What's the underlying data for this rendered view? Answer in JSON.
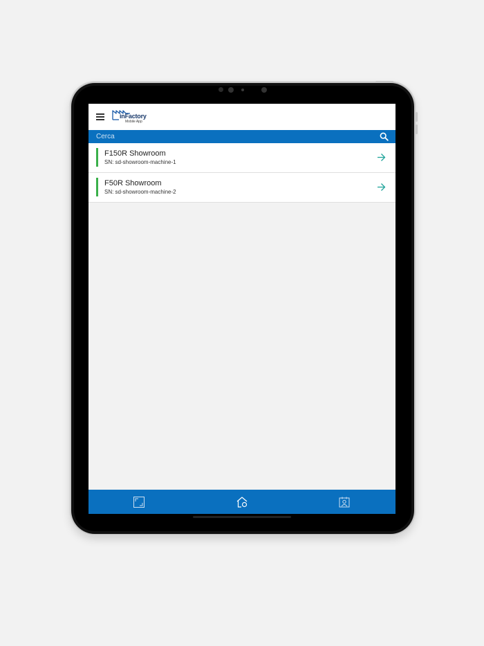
{
  "app": {
    "logo_text": "inFactory",
    "logo_subtitle": "Mobile App",
    "brand_color": "#0a70bf",
    "status_color": "#3ab04a"
  },
  "header": {
    "menu_icon": "hamburger-menu-icon"
  },
  "search": {
    "placeholder": "Cerca",
    "icon": "search-icon"
  },
  "machines": [
    {
      "name": "F150R Showroom",
      "serial": "SN: sd-showroom-machine-1",
      "icon": "arrow-right-icon"
    },
    {
      "name": "F50R Showroom",
      "serial": "SN: sd-showroom-machine-2",
      "icon": "arrow-right-icon"
    }
  ],
  "bottom_nav": {
    "items": [
      {
        "icon": "scan-icon"
      },
      {
        "icon": "home-icon"
      },
      {
        "icon": "contacts-icon"
      }
    ]
  }
}
